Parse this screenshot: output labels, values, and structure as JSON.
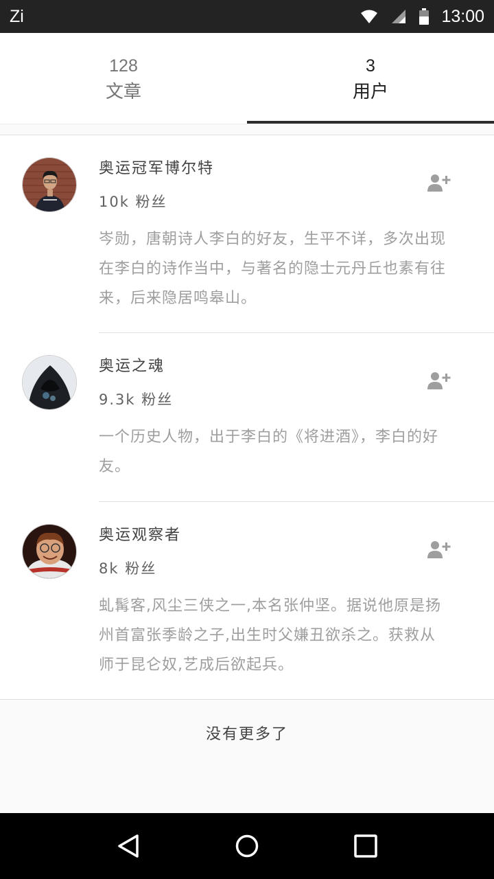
{
  "status_bar": {
    "app": "Zi",
    "time": "13:00",
    "icons": [
      "wifi-icon",
      "signal-icon",
      "battery-icon"
    ]
  },
  "tabs": [
    {
      "count": "128",
      "label": "文章",
      "active": false
    },
    {
      "count": "3",
      "label": "用户",
      "active": true
    }
  ],
  "users": [
    {
      "name": "奥运冠军博尔特",
      "fans": "10k 粉丝",
      "description": "岑勋，唐朝诗人李白的好友，生平不详，多次出现在李白的诗作当中，与著名的隐士元丹丘也素有往来，后来隐居鸣皋山。",
      "avatar": "avatar-person-brick-wall"
    },
    {
      "name": "奥运之魂",
      "fans": "9.3k 粉丝",
      "description": "一个历史人物，出于李白的《将进酒》，李白的好友。",
      "avatar": "avatar-hooded-figure"
    },
    {
      "name": "奥运观察者",
      "fans": "8k 粉丝",
      "description": "虬髯客,风尘三侠之一,本名张仲坚。据说他原是扬州首富张季龄之子,出生时父嫌丑欲杀之。获救从师于昆仑奴,艺成后欲起兵。",
      "avatar": "avatar-astronaut"
    }
  ],
  "footer": {
    "text": "没有更多了"
  },
  "nav": [
    "back-icon",
    "home-icon",
    "recents-icon"
  ],
  "colors": {
    "status_bar": "#232323",
    "active_indicator": "#2b2b2b",
    "icon_gray": "#9e9e9e",
    "desc_text": "#9e9e9e"
  }
}
